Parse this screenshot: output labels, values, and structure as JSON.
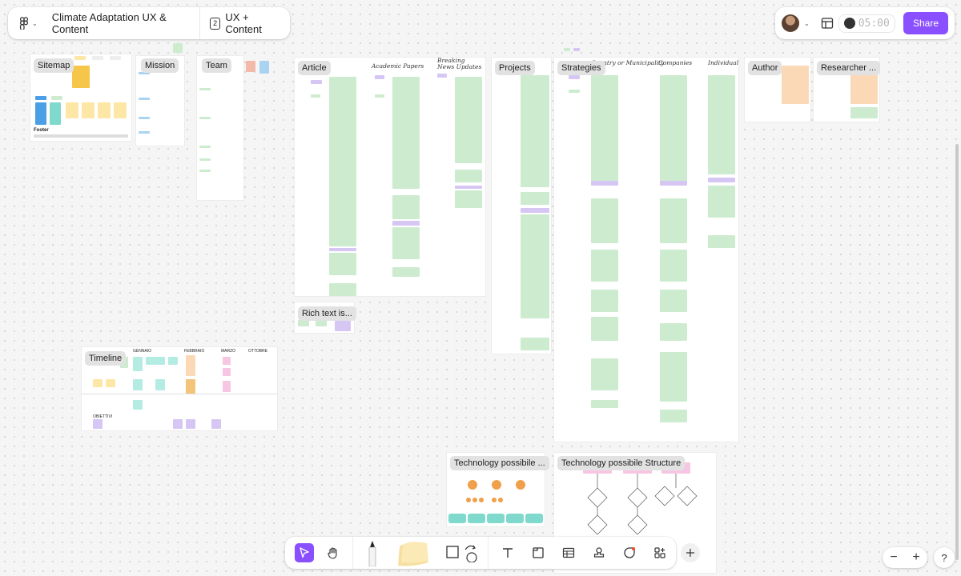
{
  "header": {
    "app_menu_icon": "figma-icon",
    "file_title": "Climate Adaptation UX & Content",
    "page_number": "2",
    "page_name": "UX + Content"
  },
  "top_right": {
    "timer": "05:00",
    "share_label": "Share"
  },
  "canvas": {
    "sections": {
      "sitemap": "Sitemap",
      "sitemap_footer": "Footer",
      "mission": "Mission",
      "team": "Team",
      "article": "Article",
      "academic_papers": "Academic Papers",
      "breaking_news": "Breaking News Updates",
      "projects": "Projects",
      "strategies": "Strategies",
      "municipality": "Country or Municipality",
      "companies": "Companies",
      "individual": "Individual",
      "author": "Author",
      "researcher": "Researcher ...",
      "rich_text": "Rich text is...",
      "timeline": "Timeline",
      "gennaio": "GENNAIO",
      "febbraio": "FEBBRAIO",
      "marzo": "MARZO",
      "ottobre": "OTTOBRE",
      "obiettivi": "OBIETTIVI",
      "tech_possible": "Technology possibile ...",
      "tech_structure": "Technology possibile Structure"
    }
  },
  "toolbar": {
    "tools": [
      "move-tool",
      "hand-tool",
      "pen-tool",
      "sticky-note-tool",
      "shape-tool",
      "text-tool",
      "section-tool",
      "table-tool",
      "stamp-tool",
      "sticker-tool",
      "widgets-tool",
      "more-tool"
    ]
  },
  "zoom": {
    "minus": "−",
    "plus": "+"
  },
  "help": {
    "label": "?"
  }
}
